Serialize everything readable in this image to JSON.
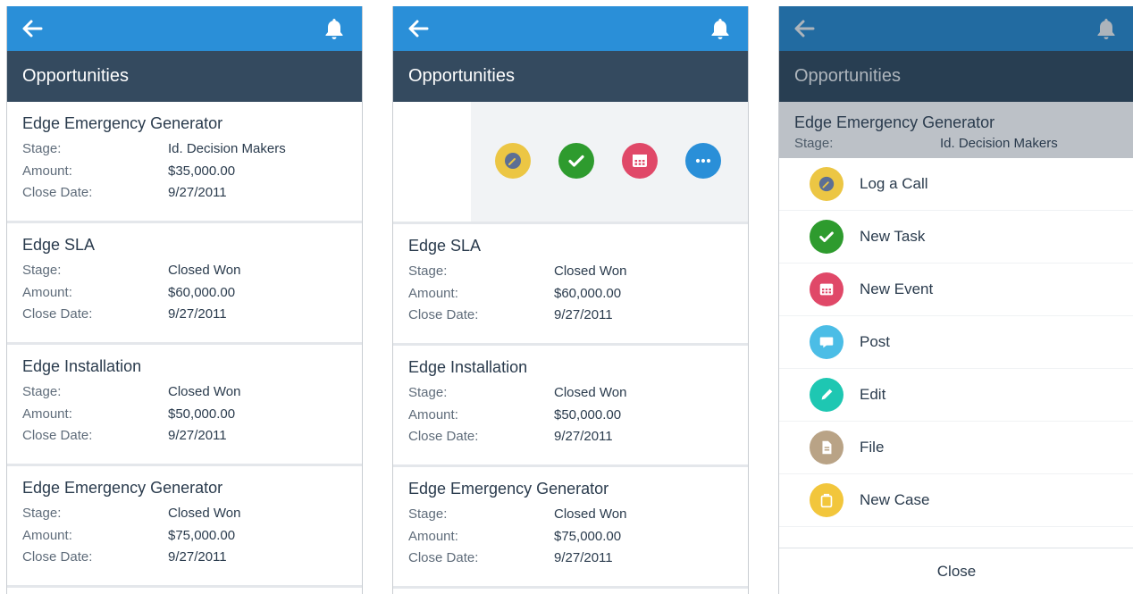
{
  "colors": {
    "topbar": "#2a8fd8",
    "titlebar": "#344a5f",
    "log_call": "#ecc644",
    "task": "#2e9b2e",
    "event": "#e04868",
    "more": "#2a8fd8",
    "post": "#4bbde6",
    "edit": "#1ec7b2",
    "file": "#b9a386",
    "case": "#f2c63c"
  },
  "screens": [
    {
      "title": "Opportunities",
      "records": [
        {
          "name": "Edge Emergency Generator",
          "stage_label": "Stage:",
          "stage": "Id. Decision Makers",
          "amount_label": "Amount:",
          "amount": "$35,000.00",
          "close_label": "Close Date:",
          "close": "9/27/2011"
        },
        {
          "name": "Edge SLA",
          "stage_label": "Stage:",
          "stage": "Closed Won",
          "amount_label": "Amount:",
          "amount": "$60,000.00",
          "close_label": "Close Date:",
          "close": "9/27/2011"
        },
        {
          "name": "Edge Installation",
          "stage_label": "Stage:",
          "stage": "Closed Won",
          "amount_label": "Amount:",
          "amount": "$50,000.00",
          "close_label": "Close Date:",
          "close": "9/27/2011"
        },
        {
          "name": "Edge Emergency Generator",
          "stage_label": "Stage:",
          "stage": "Closed Won",
          "amount_label": "Amount:",
          "amount": "$75,000.00",
          "close_label": "Close Date:",
          "close": "9/27/2011"
        }
      ]
    },
    {
      "title": "Opportunities",
      "quick_actions": [
        "log-call-icon",
        "check-icon",
        "calendar-icon",
        "more-icon"
      ],
      "records": [
        {
          "name": "Edge SLA",
          "stage_label": "Stage:",
          "stage": "Closed Won",
          "amount_label": "Amount:",
          "amount": "$60,000.00",
          "close_label": "Close Date:",
          "close": "9/27/2011"
        },
        {
          "name": "Edge Installation",
          "stage_label": "Stage:",
          "stage": "Closed Won",
          "amount_label": "Amount:",
          "amount": "$50,000.00",
          "close_label": "Close Date:",
          "close": "9/27/2011"
        },
        {
          "name": "Edge Emergency Generator",
          "stage_label": "Stage:",
          "stage": "Closed Won",
          "amount_label": "Amount:",
          "amount": "$75,000.00",
          "close_label": "Close Date:",
          "close": "9/27/2011"
        }
      ]
    },
    {
      "title": "Opportunities",
      "selected": {
        "name": "Edge Emergency Generator",
        "stage_label": "Stage:",
        "stage": "Id. Decision Makers"
      },
      "menu": [
        {
          "label": "Log a Call",
          "icon": "log-call-icon"
        },
        {
          "label": "New Task",
          "icon": "check-icon"
        },
        {
          "label": "New Event",
          "icon": "calendar-icon"
        },
        {
          "label": "Post",
          "icon": "chat-bubble-icon"
        },
        {
          "label": "Edit",
          "icon": "pencil-icon"
        },
        {
          "label": "File",
          "icon": "file-icon"
        },
        {
          "label": "New Case",
          "icon": "briefcase-icon"
        }
      ],
      "close_label": "Close"
    }
  ]
}
